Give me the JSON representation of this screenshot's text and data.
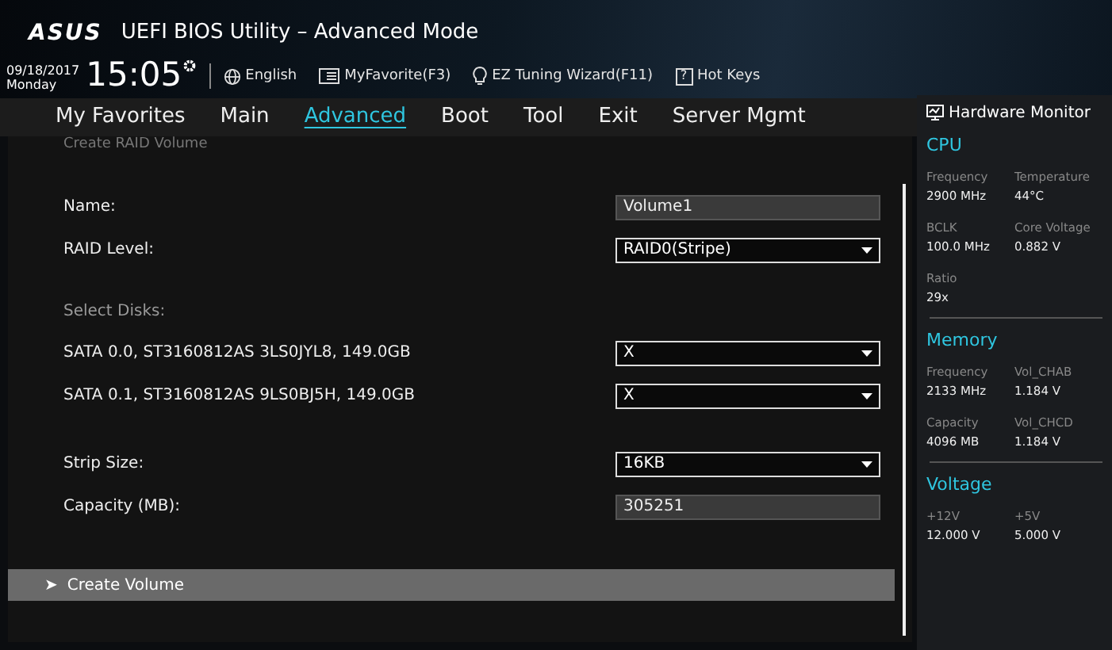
{
  "header": {
    "brand": "ASUS",
    "title": "UEFI BIOS Utility – Advanced Mode",
    "date": "09/18/2017",
    "day": "Monday",
    "time": "15:05",
    "tools": [
      {
        "kind": "globe",
        "label": "English"
      },
      {
        "kind": "favorite",
        "label": "MyFavorite(F3)"
      },
      {
        "kind": "bulb",
        "label": "EZ Tuning Wizard(F11)"
      },
      {
        "kind": "help",
        "glyph": "?",
        "label": "Hot Keys"
      }
    ]
  },
  "tabs": [
    {
      "label": "My Favorites",
      "selected": false
    },
    {
      "label": "Main",
      "selected": false
    },
    {
      "label": "Advanced",
      "selected": true
    },
    {
      "label": "Boot",
      "selected": false
    },
    {
      "label": "Tool",
      "selected": false
    },
    {
      "label": "Exit",
      "selected": false
    },
    {
      "label": "Server Mgmt",
      "selected": false
    }
  ],
  "form": {
    "title": "Create RAID Volume",
    "groups": [
      {
        "rows": [
          {
            "label": "Name:",
            "kind": "text",
            "value": "Volume1"
          },
          {
            "label": "RAID Level:",
            "kind": "dropdown",
            "value": "RAID0(Stripe)"
          }
        ]
      },
      {
        "heading": "Select Disks:",
        "rows": [
          {
            "label": "SATA 0.0, ST3160812AS 3LS0JYL8, 149.0GB",
            "kind": "dropdown",
            "value": "X"
          },
          {
            "label": "SATA 0.1, ST3160812AS 9LS0BJ5H, 149.0GB",
            "kind": "dropdown",
            "value": "X"
          }
        ]
      },
      {
        "rows": [
          {
            "label": "Strip Size:",
            "kind": "dropdown",
            "value": "16KB"
          },
          {
            "label": "Capacity (MB):",
            "kind": "text",
            "value": "305251"
          }
        ]
      }
    ],
    "action": {
      "marker": "➤",
      "label": "Create Volume",
      "selected": true
    }
  },
  "hardware_monitor": {
    "title": "Hardware Monitor",
    "sections": [
      {
        "title": "CPU",
        "items": [
          {
            "label": "Frequency",
            "value": "2900 MHz"
          },
          {
            "label": "Temperature",
            "value": "44°C"
          },
          {
            "label": "BCLK",
            "value": "100.0 MHz"
          },
          {
            "label": "Core Voltage",
            "value": "0.882 V"
          },
          {
            "label": "Ratio",
            "value": "29x"
          }
        ]
      },
      {
        "title": "Memory",
        "items": [
          {
            "label": "Frequency",
            "value": "2133 MHz"
          },
          {
            "label": "Vol_CHAB",
            "value": "1.184 V"
          },
          {
            "label": "Capacity",
            "value": "4096 MB"
          },
          {
            "label": "Vol_CHCD",
            "value": "1.184 V"
          }
        ]
      },
      {
        "title": "Voltage",
        "items": [
          {
            "label": "+12V",
            "value": "12.000 V"
          },
          {
            "label": "+5V",
            "value": "5.000 V"
          }
        ]
      }
    ]
  }
}
